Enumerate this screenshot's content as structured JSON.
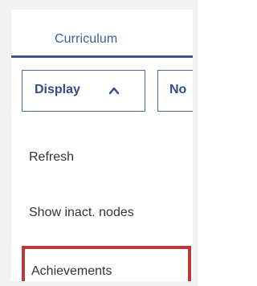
{
  "tab": {
    "label": "Curriculum"
  },
  "toolbar": {
    "display_label": "Display",
    "next_label_partial": "No"
  },
  "menu": {
    "items": [
      {
        "label": "Refresh"
      },
      {
        "label": "Show inact. nodes"
      },
      {
        "label": "Achievements"
      }
    ]
  },
  "colors": {
    "accent": "#3b5b8c",
    "highlight": "#b93a3a",
    "text": "#333333"
  },
  "icons": {
    "display_chevron": "chevron-up-icon"
  }
}
